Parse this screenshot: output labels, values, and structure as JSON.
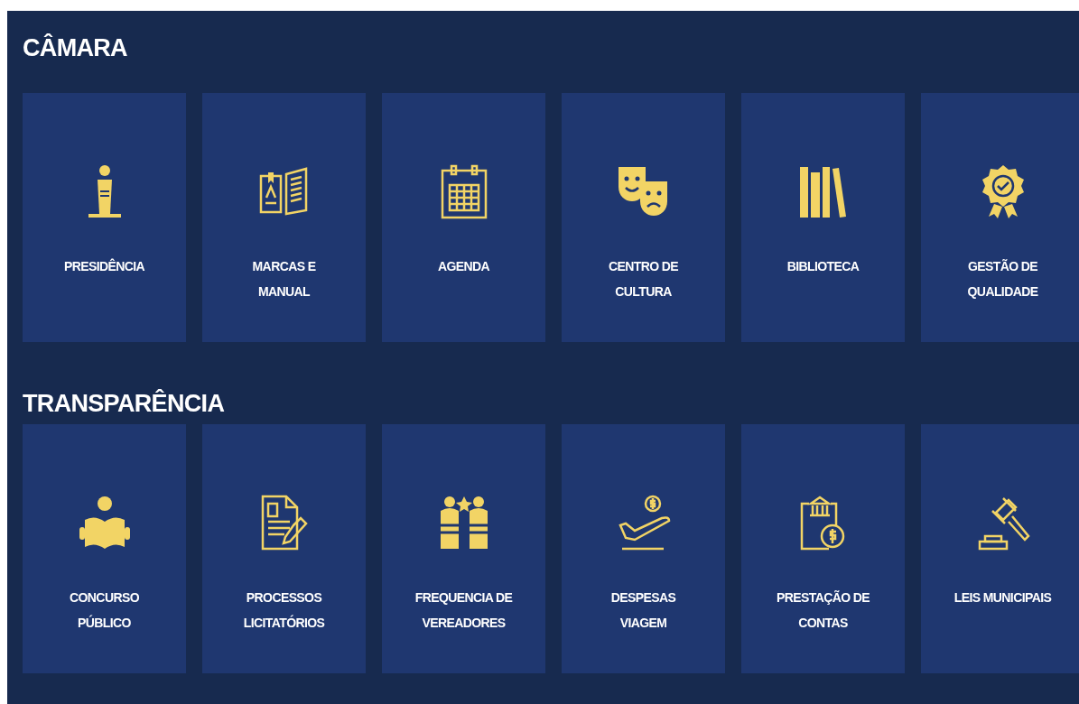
{
  "sections": [
    {
      "title": "CÂMARA",
      "items": [
        {
          "label": "PRESIDÊNCIA"
        },
        {
          "label": "MARCAS E MANUAL"
        },
        {
          "label": "AGENDA"
        },
        {
          "label": "CENTRO DE CULTURA"
        },
        {
          "label": "BIBLIOTECA"
        },
        {
          "label": "GESTÃO DE QUALIDADE"
        }
      ]
    },
    {
      "title": "TRANSPARÊNCIA",
      "items": [
        {
          "label": "CONCURSO PÚBLICO"
        },
        {
          "label": "PROCESSOS LICITATÓRIOS"
        },
        {
          "label": "FREQUENCIA DE VEREADORES"
        },
        {
          "label": "DESPESAS VIAGEM"
        },
        {
          "label": "PRESTAÇÃO DE CONTAS"
        },
        {
          "label": "LEIS MUNICIPAIS"
        }
      ]
    }
  ]
}
